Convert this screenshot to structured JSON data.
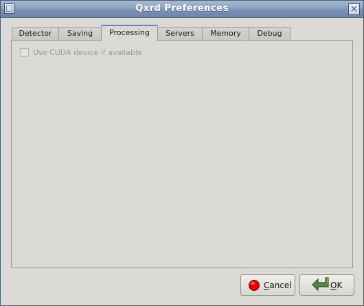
{
  "window": {
    "title": "Qxrd Preferences",
    "close_glyph": "×"
  },
  "tabs": [
    {
      "label": "Detector",
      "active": false
    },
    {
      "label": "Saving",
      "active": false
    },
    {
      "label": "Processing",
      "active": true
    },
    {
      "label": "Servers",
      "active": false
    },
    {
      "label": "Memory",
      "active": false
    },
    {
      "label": "Debug",
      "active": false
    }
  ],
  "processing": {
    "use_cuda_label": "Use CUDA device if available",
    "use_cuda_checked": false,
    "use_cuda_enabled": false
  },
  "buttons": {
    "cancel_label": "Cancel",
    "cancel_icon": "stop-icon",
    "ok_label": "OK",
    "ok_icon": "enter-arrow-icon"
  },
  "colors": {
    "titlebar": "#8aa2c1",
    "active_tab_accent": "#5b87c6",
    "cancel_icon_red": "#e00000",
    "ok_icon_green": "#5a8a3a"
  }
}
